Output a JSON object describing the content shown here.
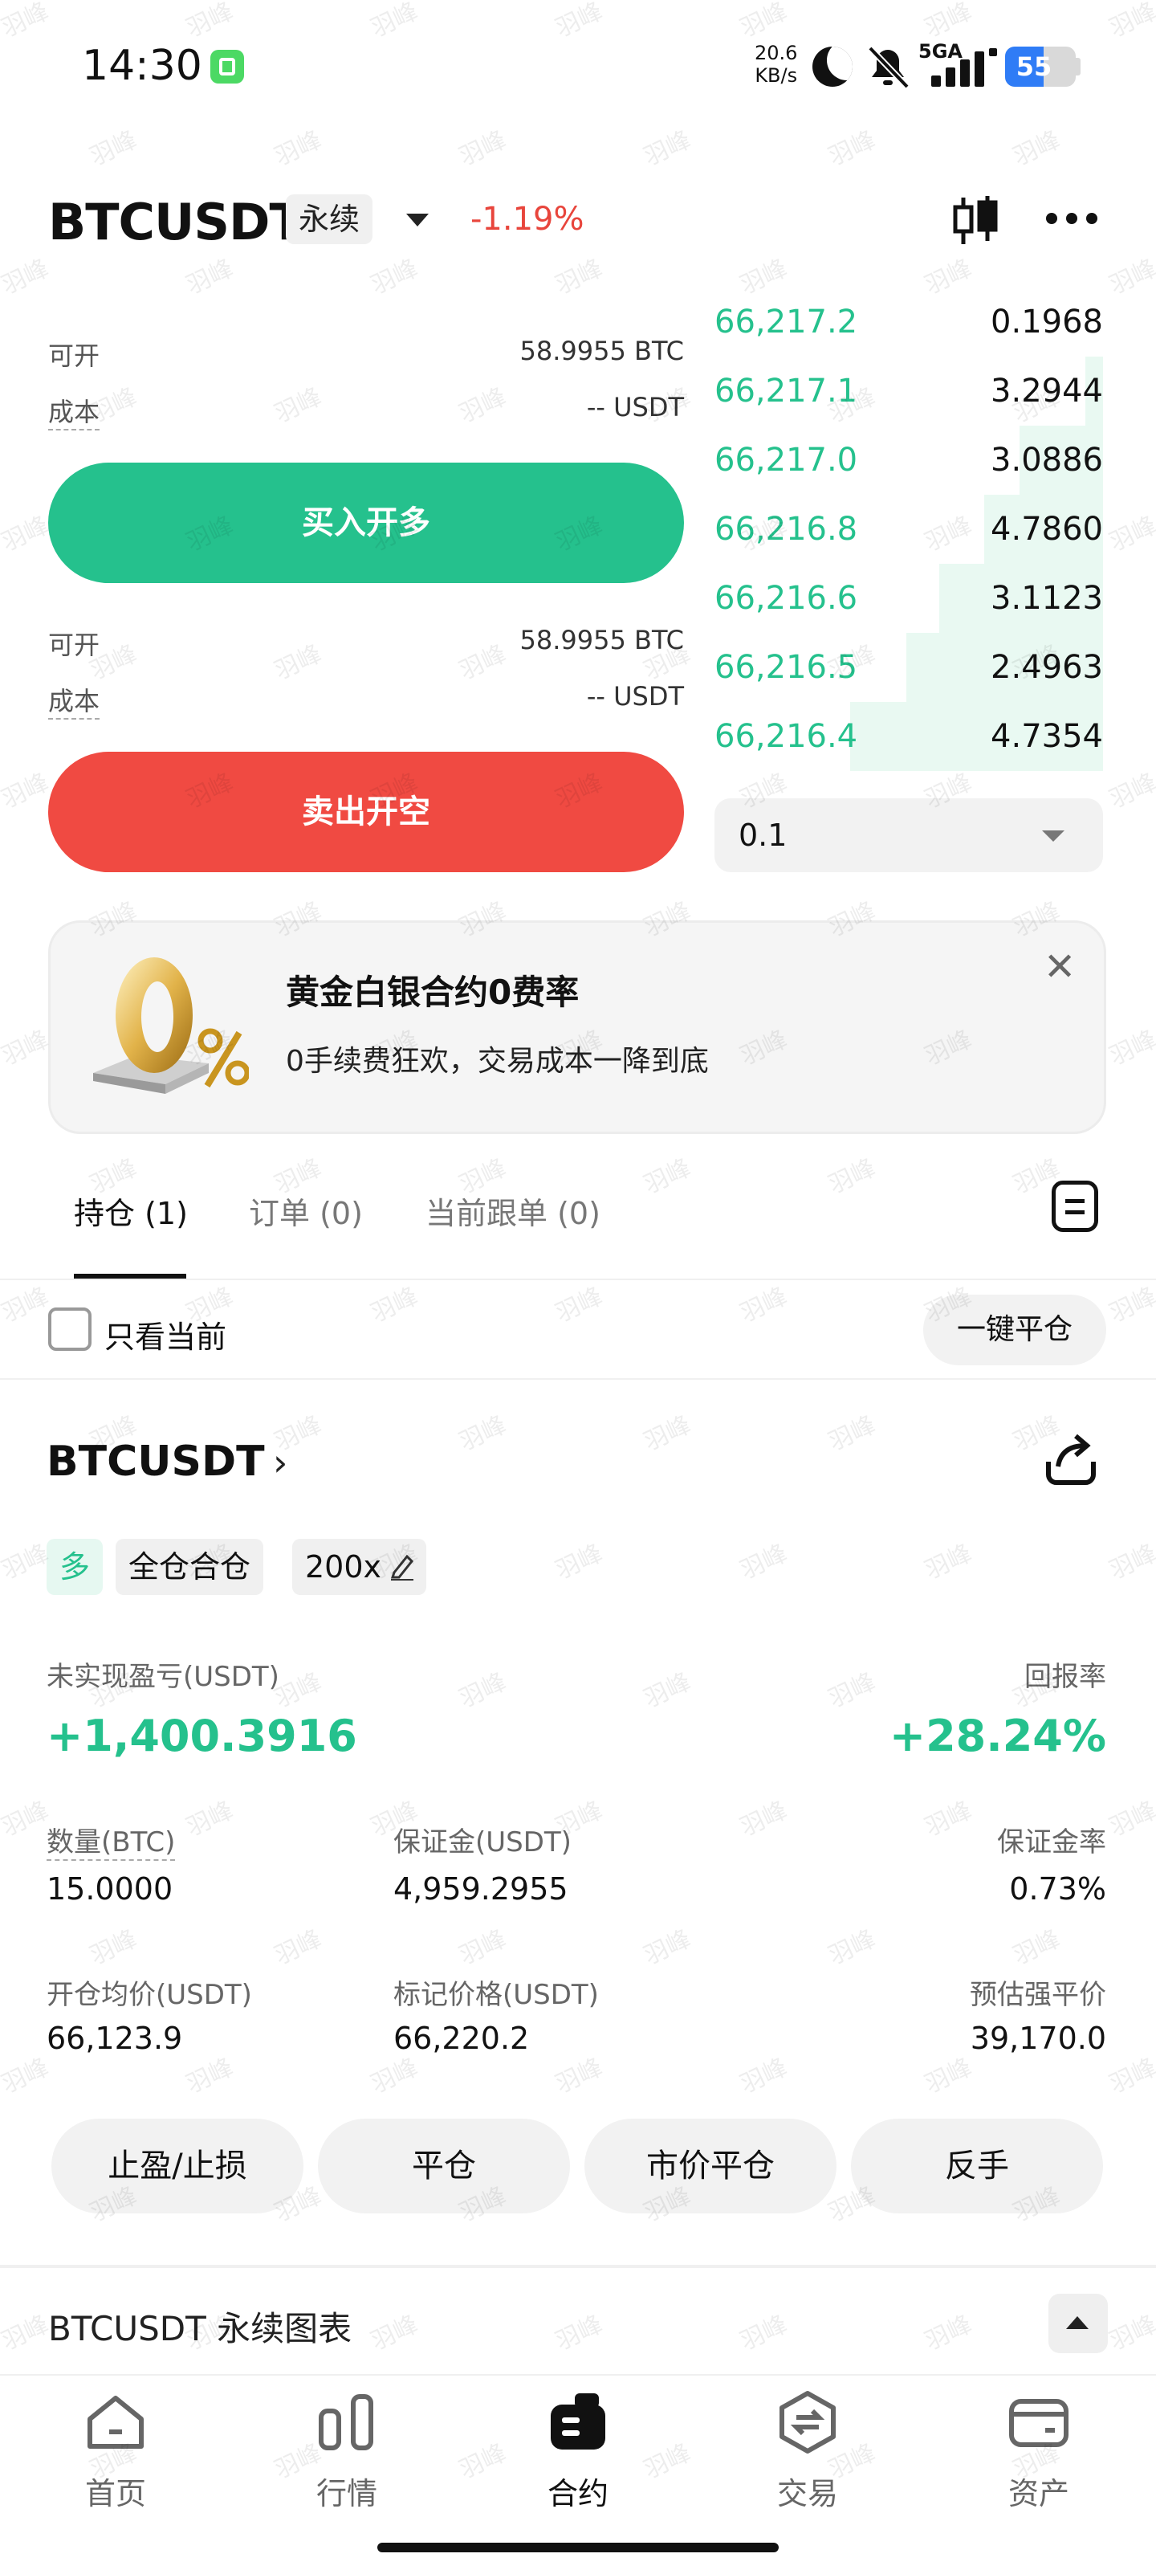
{
  "status_bar": {
    "time": "14:30",
    "net_speed_value": "20.6",
    "net_speed_unit": "KB/s",
    "network": "5GA",
    "battery": "55",
    "battery_level_percent": 55
  },
  "header": {
    "symbol": "BTCUSDT",
    "contract_type": "永续",
    "change": "-1.19%",
    "candle_icon": "candlestick-icon",
    "more_icon": "more-icon"
  },
  "long_panel": {
    "available_label": "可开",
    "available_value": "58.9955 BTC",
    "cost_label": "成本",
    "cost_value": "-- USDT",
    "button": "买入开多"
  },
  "short_panel": {
    "available_label": "可开",
    "available_value": "58.9955 BTC",
    "cost_label": "成本",
    "cost_value": "-- USDT",
    "button": "卖出开空"
  },
  "order_book": {
    "rows": [
      {
        "price": "66,217.2",
        "qty": "0.1968",
        "depth": 0.0
      },
      {
        "price": "66,217.1",
        "qty": "3.2944",
        "depth": 0.07
      },
      {
        "price": "66,217.0",
        "qty": "3.0886",
        "depth": 0.33
      },
      {
        "price": "66,216.8",
        "qty": "4.7860",
        "depth": 0.47
      },
      {
        "price": "66,216.6",
        "qty": "3.1123",
        "depth": 0.65
      },
      {
        "price": "66,216.5",
        "qty": "2.4963",
        "depth": 0.78
      },
      {
        "price": "66,216.4",
        "qty": "4.7354",
        "depth": 1.0
      }
    ],
    "precision_value": "0.1"
  },
  "banner": {
    "title": "黄金白银合约0费率",
    "subtitle": "0手续费狂欢，交易成本一降到底",
    "image_text": "0%"
  },
  "tabs": [
    {
      "label": "持仓 (1)"
    },
    {
      "label": "订单 (0)"
    },
    {
      "label": "当前跟单 (0)"
    }
  ],
  "filter": {
    "only_current": "只看当前",
    "close_all": "一键平仓"
  },
  "position": {
    "symbol": "BTCUSDT",
    "direction": "多",
    "margin_mode": "全仓合仓",
    "leverage": "200x",
    "unrealized_label": "未实现盈亏(USDT)",
    "unrealized_value": "+1,400.3916",
    "roe_label": "回报率",
    "roe_value": "+28.24%",
    "qty_label": "数量(BTC)",
    "qty_value": "15.0000",
    "margin_label": "保证金(USDT)",
    "margin_value": "4,959.2955",
    "margin_ratio_label": "保证金率",
    "margin_ratio_value": "0.73%",
    "entry_label": "开仓均价(USDT)",
    "entry_value": "66,123.9",
    "mark_label": "标记价格(USDT)",
    "mark_value": "66,220.2",
    "liq_label": "预估强平价",
    "liq_value": "39,170.0"
  },
  "actions": [
    "止盈/止损",
    "平仓",
    "市价平仓",
    "反手"
  ],
  "chart_section": {
    "title": "BTCUSDT 永续图表"
  },
  "bottom_nav": [
    {
      "label": "首页",
      "icon": "home-icon"
    },
    {
      "label": "行情",
      "icon": "market-icon"
    },
    {
      "label": "合约",
      "icon": "futures-icon"
    },
    {
      "label": "交易",
      "icon": "trade-icon"
    },
    {
      "label": "资产",
      "icon": "wallet-icon"
    }
  ],
  "watermark": "羽峰",
  "colors": {
    "green": "#25c18d",
    "red": "#f04a42",
    "blue": "#2f7cf6"
  }
}
